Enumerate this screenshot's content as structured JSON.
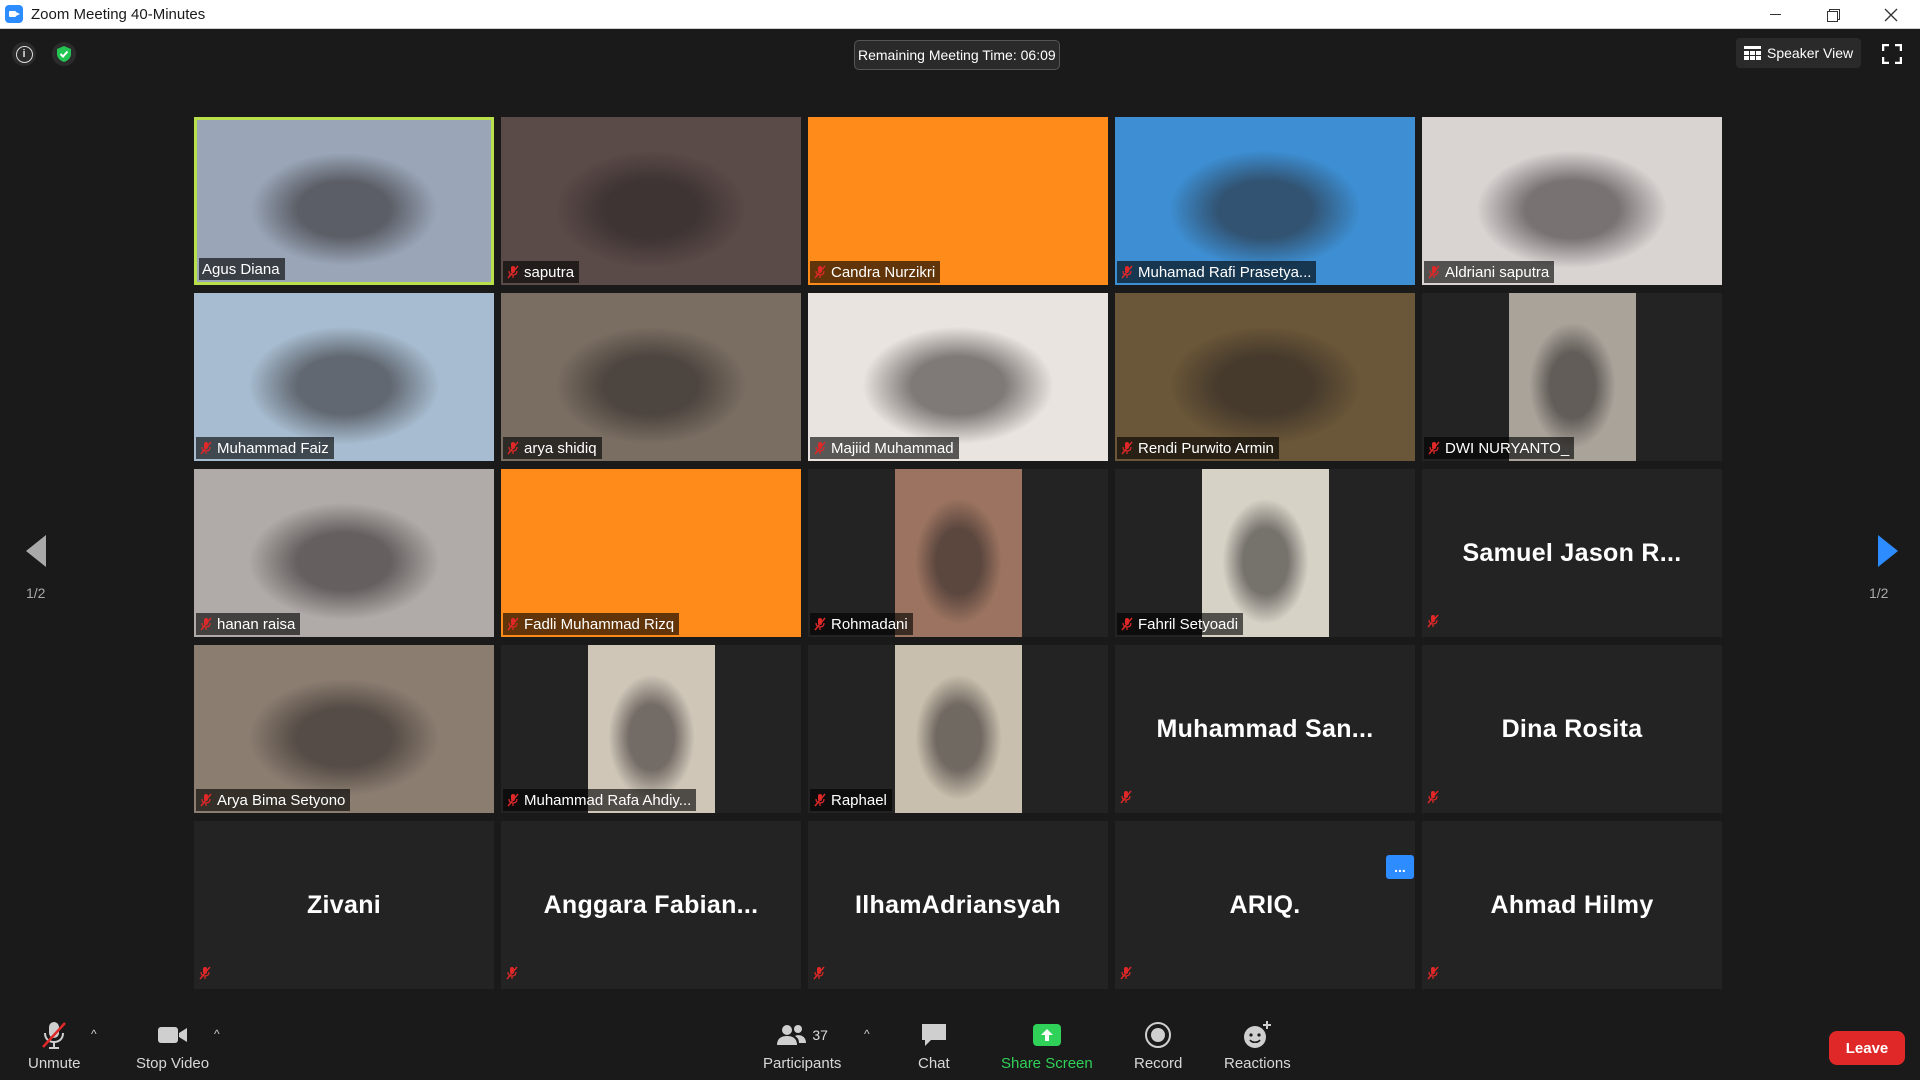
{
  "window": {
    "title": "Zoom Meeting 40-Minutes"
  },
  "meeting": {
    "timer": "Remaining Meeting Time: 06:09",
    "view_label": "Speaker View",
    "page_left": "1/2",
    "page_right": "1/2"
  },
  "tiles": [
    {
      "name": "Agus Diana",
      "type": "video",
      "muted": false,
      "bg": "#9aa6b8",
      "active": true
    },
    {
      "name": "saputra",
      "type": "video",
      "muted": true,
      "bg": "#5a4a48"
    },
    {
      "name": "Candra Nurzikri",
      "type": "color",
      "muted": true,
      "bg": "#ff8c1a"
    },
    {
      "name": "Muhamad Rafi Prasetya...",
      "type": "video",
      "muted": true,
      "bg": "#3d8ed2"
    },
    {
      "name": "Aldriani saputra",
      "type": "video",
      "muted": true,
      "bg": "#d9d4d2"
    },
    {
      "name": "Muhammad Faiz",
      "type": "video",
      "muted": true,
      "bg": "#a7bcd0"
    },
    {
      "name": "arya shidiq",
      "type": "video",
      "muted": true,
      "bg": "#7a6e62"
    },
    {
      "name": "Majiid Muhammad",
      "type": "video",
      "muted": true,
      "bg": "#e9e4df"
    },
    {
      "name": "Rendi Purwito Armin",
      "type": "video",
      "muted": true,
      "bg": "#6a5638"
    },
    {
      "name": "DWI NURYANTO_",
      "type": "video_center",
      "muted": true,
      "bg": "#a9a39a"
    },
    {
      "name": "hanan raisa",
      "type": "video",
      "muted": true,
      "bg": "#b0aaa8"
    },
    {
      "name": "Fadli Muhammad Rizq",
      "type": "color",
      "muted": true,
      "bg": "#ff8c1a"
    },
    {
      "name": "Rohmadani",
      "type": "video_center",
      "muted": true,
      "bg": "#9b7360"
    },
    {
      "name": "Fahril Setyoadi",
      "type": "video_center",
      "muted": true,
      "bg": "#d6d2c6"
    },
    {
      "name": "Samuel Jason R...",
      "type": "name",
      "muted": true
    },
    {
      "name": "Arya Bima Setyono",
      "type": "video",
      "muted": true,
      "bg": "#8b7d70"
    },
    {
      "name": "Muhammad Rafa Ahdiy...",
      "type": "video_center",
      "muted": true,
      "bg": "#cfc6b8"
    },
    {
      "name": "Raphael",
      "type": "video_center",
      "muted": true,
      "bg": "#c9bfae"
    },
    {
      "name": "Muhammad  San...",
      "type": "name",
      "muted": true
    },
    {
      "name": "Dina Rosita",
      "type": "name",
      "muted": true
    },
    {
      "name": "Zivani",
      "type": "name",
      "muted": true
    },
    {
      "name": "Anggara  Fabian...",
      "type": "name",
      "muted": true
    },
    {
      "name": "IlhamAdriansyah",
      "type": "name",
      "muted": true
    },
    {
      "name": "ARIQ.",
      "type": "name",
      "muted": true
    },
    {
      "name": "Ahmad Hilmy",
      "type": "name",
      "muted": true
    }
  ],
  "more_button": "...",
  "toolbar": {
    "unmute": "Unmute",
    "stop_video": "Stop Video",
    "participants": "Participants",
    "participants_count": "37",
    "chat": "Chat",
    "share_screen": "Share Screen",
    "record": "Record",
    "reactions": "Reactions",
    "leave": "Leave"
  },
  "colors": {
    "accent": "#2d8cff",
    "share": "#30d158",
    "leave": "#e02828",
    "active_border": "#b8e04a",
    "muted_mic": "#e02828"
  }
}
